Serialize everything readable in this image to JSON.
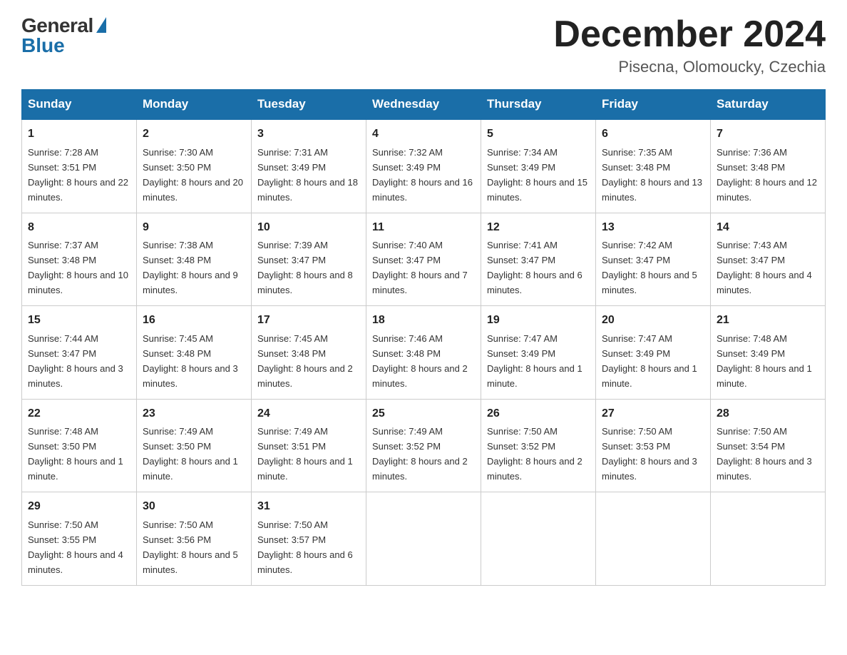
{
  "header": {
    "logo_general": "General",
    "logo_blue": "Blue",
    "month_year": "December 2024",
    "location": "Pisecna, Olomoucky, Czechia"
  },
  "days_of_week": [
    "Sunday",
    "Monday",
    "Tuesday",
    "Wednesday",
    "Thursday",
    "Friday",
    "Saturday"
  ],
  "weeks": [
    [
      {
        "day": "1",
        "sunrise": "7:28 AM",
        "sunset": "3:51 PM",
        "daylight": "8 hours and 22 minutes."
      },
      {
        "day": "2",
        "sunrise": "7:30 AM",
        "sunset": "3:50 PM",
        "daylight": "8 hours and 20 minutes."
      },
      {
        "day": "3",
        "sunrise": "7:31 AM",
        "sunset": "3:49 PM",
        "daylight": "8 hours and 18 minutes."
      },
      {
        "day": "4",
        "sunrise": "7:32 AM",
        "sunset": "3:49 PM",
        "daylight": "8 hours and 16 minutes."
      },
      {
        "day": "5",
        "sunrise": "7:34 AM",
        "sunset": "3:49 PM",
        "daylight": "8 hours and 15 minutes."
      },
      {
        "day": "6",
        "sunrise": "7:35 AM",
        "sunset": "3:48 PM",
        "daylight": "8 hours and 13 minutes."
      },
      {
        "day": "7",
        "sunrise": "7:36 AM",
        "sunset": "3:48 PM",
        "daylight": "8 hours and 12 minutes."
      }
    ],
    [
      {
        "day": "8",
        "sunrise": "7:37 AM",
        "sunset": "3:48 PM",
        "daylight": "8 hours and 10 minutes."
      },
      {
        "day": "9",
        "sunrise": "7:38 AM",
        "sunset": "3:48 PM",
        "daylight": "8 hours and 9 minutes."
      },
      {
        "day": "10",
        "sunrise": "7:39 AM",
        "sunset": "3:47 PM",
        "daylight": "8 hours and 8 minutes."
      },
      {
        "day": "11",
        "sunrise": "7:40 AM",
        "sunset": "3:47 PM",
        "daylight": "8 hours and 7 minutes."
      },
      {
        "day": "12",
        "sunrise": "7:41 AM",
        "sunset": "3:47 PM",
        "daylight": "8 hours and 6 minutes."
      },
      {
        "day": "13",
        "sunrise": "7:42 AM",
        "sunset": "3:47 PM",
        "daylight": "8 hours and 5 minutes."
      },
      {
        "day": "14",
        "sunrise": "7:43 AM",
        "sunset": "3:47 PM",
        "daylight": "8 hours and 4 minutes."
      }
    ],
    [
      {
        "day": "15",
        "sunrise": "7:44 AM",
        "sunset": "3:47 PM",
        "daylight": "8 hours and 3 minutes."
      },
      {
        "day": "16",
        "sunrise": "7:45 AM",
        "sunset": "3:48 PM",
        "daylight": "8 hours and 3 minutes."
      },
      {
        "day": "17",
        "sunrise": "7:45 AM",
        "sunset": "3:48 PM",
        "daylight": "8 hours and 2 minutes."
      },
      {
        "day": "18",
        "sunrise": "7:46 AM",
        "sunset": "3:48 PM",
        "daylight": "8 hours and 2 minutes."
      },
      {
        "day": "19",
        "sunrise": "7:47 AM",
        "sunset": "3:49 PM",
        "daylight": "8 hours and 1 minute."
      },
      {
        "day": "20",
        "sunrise": "7:47 AM",
        "sunset": "3:49 PM",
        "daylight": "8 hours and 1 minute."
      },
      {
        "day": "21",
        "sunrise": "7:48 AM",
        "sunset": "3:49 PM",
        "daylight": "8 hours and 1 minute."
      }
    ],
    [
      {
        "day": "22",
        "sunrise": "7:48 AM",
        "sunset": "3:50 PM",
        "daylight": "8 hours and 1 minute."
      },
      {
        "day": "23",
        "sunrise": "7:49 AM",
        "sunset": "3:50 PM",
        "daylight": "8 hours and 1 minute."
      },
      {
        "day": "24",
        "sunrise": "7:49 AM",
        "sunset": "3:51 PM",
        "daylight": "8 hours and 1 minute."
      },
      {
        "day": "25",
        "sunrise": "7:49 AM",
        "sunset": "3:52 PM",
        "daylight": "8 hours and 2 minutes."
      },
      {
        "day": "26",
        "sunrise": "7:50 AM",
        "sunset": "3:52 PM",
        "daylight": "8 hours and 2 minutes."
      },
      {
        "day": "27",
        "sunrise": "7:50 AM",
        "sunset": "3:53 PM",
        "daylight": "8 hours and 3 minutes."
      },
      {
        "day": "28",
        "sunrise": "7:50 AM",
        "sunset": "3:54 PM",
        "daylight": "8 hours and 3 minutes."
      }
    ],
    [
      {
        "day": "29",
        "sunrise": "7:50 AM",
        "sunset": "3:55 PM",
        "daylight": "8 hours and 4 minutes."
      },
      {
        "day": "30",
        "sunrise": "7:50 AM",
        "sunset": "3:56 PM",
        "daylight": "8 hours and 5 minutes."
      },
      {
        "day": "31",
        "sunrise": "7:50 AM",
        "sunset": "3:57 PM",
        "daylight": "8 hours and 6 minutes."
      },
      null,
      null,
      null,
      null
    ]
  ]
}
